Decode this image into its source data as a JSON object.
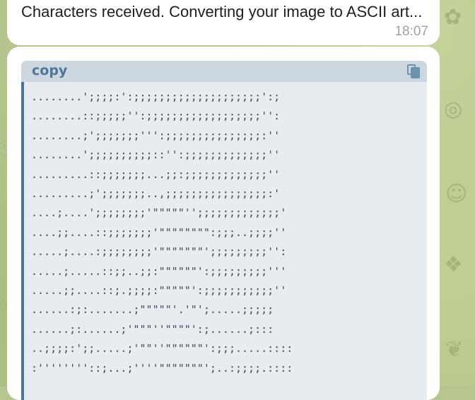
{
  "chat": {
    "message1": {
      "text": "Characters received. Converting your image to ASCII art...",
      "time": "18:07"
    },
    "code_block": {
      "language": "copy",
      "copy_icon": "copy-icon",
      "ascii_lines": [
        "........';;;;:':;;;;;;;;;;;;;;;;;;;;':;",
        "........::;;;;;'':;;;;;;;;;;;;;;;;;;'':",
        "........;';;;;;;;''':;;;;;;;;;;;;;;;:''",
        "........';;;;;;;;;;::'':;;;;;;;;;;;;;''",
        ".........::;;;;;;;...;;:;;;;;;;;;;;;;''",
        ".........;';;;;;;;..,;;;;;;;;;;;;;;;;:'",
        "....;....';;;;;;;;'\"\"\"\"\"'';;;;;;;;;;;;;'",
        "....;;....::;;;;;;;'\"\"\"\"\"\"\"\":;;;..;;;;''",
        ".....;....:;;;;;;;;'\"\"\"\"\"\"\"';;;;;;;;;'':",
        ".....;.....::;;..;;:\"\"\"\"\"\"':;;;;;;;;;'''",
        ".....;;....::;.;;;;:\"\"\"\"\"':;;;;;;;;;;;''",
        "......:;:.......;\"\"\"\"\"'.'\"';.....;;;;;",
        "......;:......;'\"\"\"''\"\"\"\"':;......;:::",
        "..;;;;:';;.....;'\"\"''\"\"\"\"\"\"':;;;.....::::",
        ":''''''''::;...;''''\"\"\"\"\"\"\"';..:;;;;.::::"
      ]
    }
  }
}
